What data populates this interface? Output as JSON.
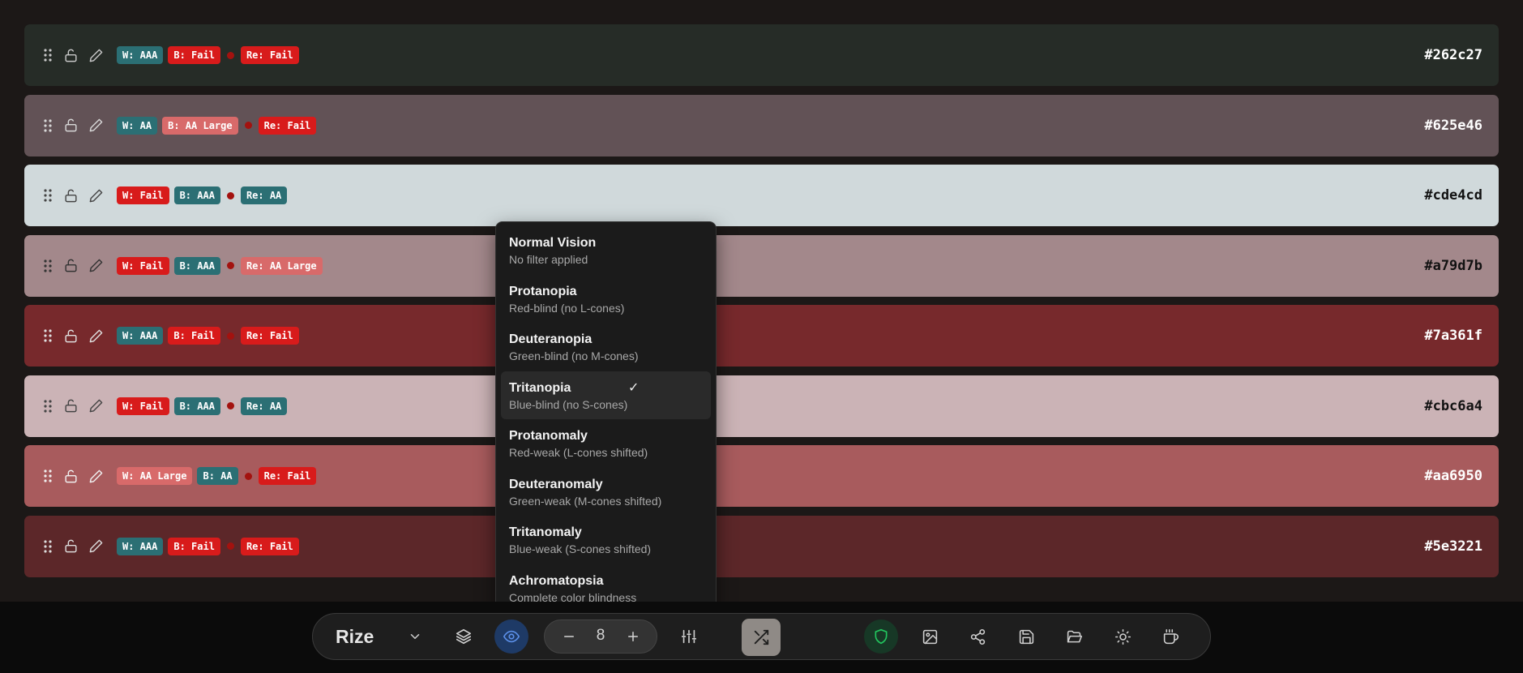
{
  "swatches": [
    {
      "hex": "#262c27",
      "bg": "#262c27",
      "text_color": "#ffffff",
      "icon_color": "#c8c8c8",
      "white": {
        "label": "W: AAA",
        "status": "good"
      },
      "black": {
        "label": "B: Fail",
        "status": "fail"
      },
      "ref": {
        "label": "Re: Fail",
        "status": "fail"
      }
    },
    {
      "hex": "#625e46",
      "bg": "#625256",
      "text_color": "#ffffff",
      "icon_color": "#d8d8d8",
      "white": {
        "label": "W: AA",
        "status": "good"
      },
      "black": {
        "label": "B: AA Large",
        "status": "large"
      },
      "ref": {
        "label": "Re: Fail",
        "status": "fail"
      }
    },
    {
      "hex": "#cde4cd",
      "bg": "#d0d9db",
      "text_color": "#111111",
      "icon_color": "#444444",
      "white": {
        "label": "W: Fail",
        "status": "fail"
      },
      "black": {
        "label": "B: AAA",
        "status": "good"
      },
      "ref": {
        "label": "Re: AA",
        "status": "good"
      }
    },
    {
      "hex": "#a79d7b",
      "bg": "#a3888b",
      "text_color": "#111111",
      "icon_color": "#333333",
      "white": {
        "label": "W: Fail",
        "status": "fail"
      },
      "black": {
        "label": "B: AAA",
        "status": "good"
      },
      "ref": {
        "label": "Re: AA Large",
        "status": "large"
      }
    },
    {
      "hex": "#7a361f",
      "bg": "#77292c",
      "text_color": "#ffffff",
      "icon_color": "#e0e0e0",
      "white": {
        "label": "W: AAA",
        "status": "good"
      },
      "black": {
        "label": "B: Fail",
        "status": "fail"
      },
      "ref": {
        "label": "Re: Fail",
        "status": "fail"
      }
    },
    {
      "hex": "#cbc6a4",
      "bg": "#cbb3b6",
      "text_color": "#111111",
      "icon_color": "#444444",
      "white": {
        "label": "W: Fail",
        "status": "fail"
      },
      "black": {
        "label": "B: AAA",
        "status": "good"
      },
      "ref": {
        "label": "Re: AA",
        "status": "good"
      }
    },
    {
      "hex": "#aa6950",
      "bg": "#a85b5d",
      "text_color": "#ffffff",
      "icon_color": "#f0f0f0",
      "white": {
        "label": "W: AA Large",
        "status": "large"
      },
      "black": {
        "label": "B: AA",
        "status": "good"
      },
      "ref": {
        "label": "Re: Fail",
        "status": "fail"
      }
    },
    {
      "hex": "#5e3221",
      "bg": "#5c2729",
      "text_color": "#ffffff",
      "icon_color": "#dcdcdc",
      "white": {
        "label": "W: AAA",
        "status": "good"
      },
      "black": {
        "label": "B: Fail",
        "status": "fail"
      },
      "ref": {
        "label": "Re: Fail",
        "status": "fail"
      }
    }
  ],
  "vision_menu": {
    "items": [
      {
        "name": "Normal Vision",
        "desc": "No filter applied"
      },
      {
        "name": "Protanopia",
        "desc": "Red-blind (no L-cones)"
      },
      {
        "name": "Deuteranopia",
        "desc": "Green-blind (no M-cones)"
      },
      {
        "name": "Tritanopia",
        "desc": "Blue-blind (no S-cones)",
        "selected": true
      },
      {
        "name": "Protanomaly",
        "desc": "Red-weak (L-cones shifted)"
      },
      {
        "name": "Deuteranomaly",
        "desc": "Green-weak (M-cones shifted)"
      },
      {
        "name": "Tritanomaly",
        "desc": "Blue-weak (S-cones shifted)"
      },
      {
        "name": "Achromatopsia",
        "desc": "Complete color blindness"
      }
    ],
    "check_mark": "✓"
  },
  "toolbar": {
    "brand": "Rize",
    "count": "8",
    "colors": {
      "vision_active": "#1e3a66",
      "vision_icon": "#5b8fe8",
      "shield": "#22c55e",
      "shuffle_bg": "#8f8a86"
    }
  },
  "badge_colors": {
    "good": "#2b6f74",
    "fail": "#d81b1b",
    "large": "#d86a6a"
  }
}
